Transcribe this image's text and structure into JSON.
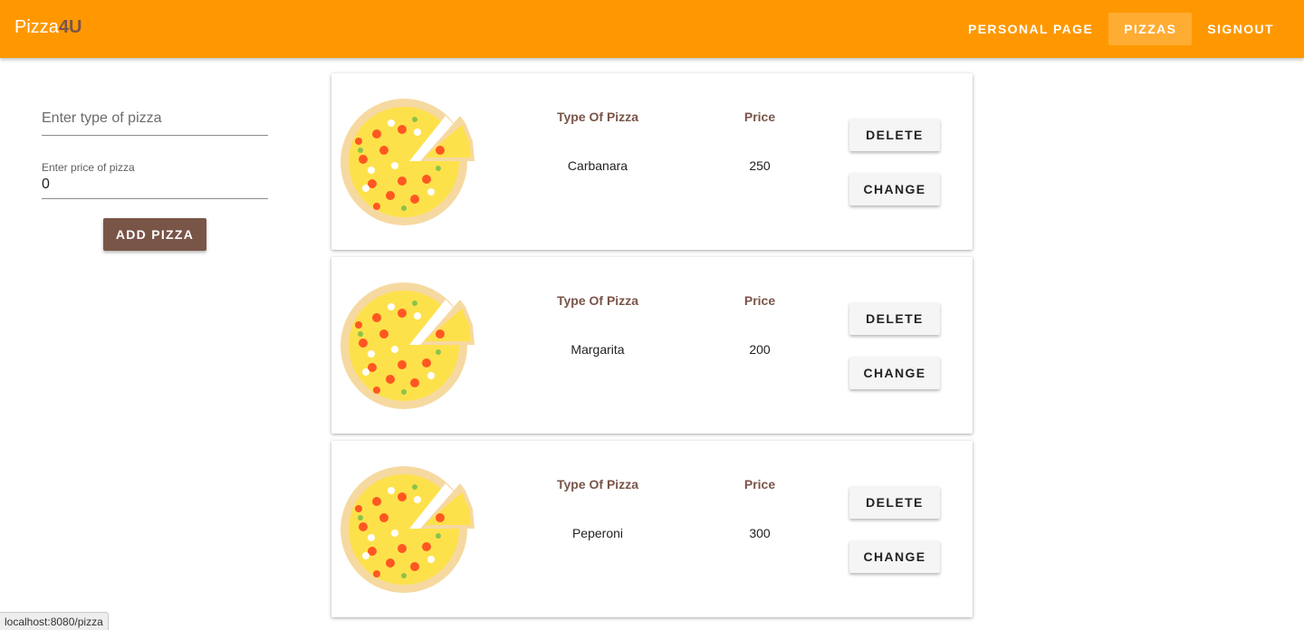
{
  "brand": {
    "name": "Pizza",
    "accent": "4U"
  },
  "nav": [
    {
      "label": "PERSONAL PAGE",
      "active": false
    },
    {
      "label": "PIZZAS",
      "active": true
    },
    {
      "label": "SIGNOUT",
      "active": false
    }
  ],
  "form": {
    "type_placeholder": "Enter type of pizza",
    "type_value": "",
    "price_label": "Enter price of pizza",
    "price_value": "0",
    "add_label": "ADD PIZZA"
  },
  "columns": {
    "type": "Type Of Pizza",
    "price": "Price"
  },
  "buttons": {
    "delete": "DELETE",
    "change": "CHANGE"
  },
  "pizzas": [
    {
      "type": "Carbanara",
      "price": "250"
    },
    {
      "type": "Margarita",
      "price": "200"
    },
    {
      "type": "Peperoni",
      "price": "300"
    }
  ],
  "status_url": "localhost:8080/pizza",
  "colors": {
    "appbar": "#ff9800",
    "accent": "#795548"
  },
  "icons": {
    "card_image": "pizza-icon"
  }
}
